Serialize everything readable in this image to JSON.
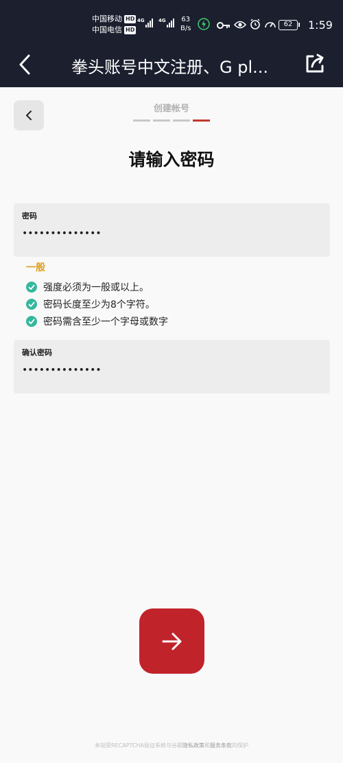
{
  "status_bar": {
    "carrier_1": "中国移动",
    "carrier_2": "中国电信",
    "hd_label": "HD",
    "network_1": "4G",
    "network_2": "4G",
    "speed_value": "63",
    "speed_unit": "B/s",
    "battery": "62",
    "time": "1:59"
  },
  "header": {
    "title": "拳头账号中文注册、G pl...",
    "back_icon": "chevron-left-icon",
    "share_icon": "share-icon"
  },
  "form": {
    "step_label": "创建帐号",
    "steps_total": 4,
    "steps_current": 4,
    "heading": "请输入密码",
    "password": {
      "label": "密码",
      "value": "••••••••••••••"
    },
    "strength": "一般",
    "rules": [
      "强度必须为一般或以上。",
      "密码长度至少为8个字符。",
      "密码需含至少一个字母或数字"
    ],
    "confirm": {
      "label": "确认密码",
      "value": "••••••••••••••"
    }
  },
  "footer": {
    "prefix": "本站受RECAPTCHA验证系统与谷歌",
    "privacy": "隐私政策",
    "and": "和",
    "terms": "服务条款",
    "suffix": "的保护"
  },
  "colors": {
    "header_bg": "#1b1f2e",
    "accent_red": "#c1232b",
    "check_green": "#35b89c",
    "strength_orange": "#e0a020"
  }
}
